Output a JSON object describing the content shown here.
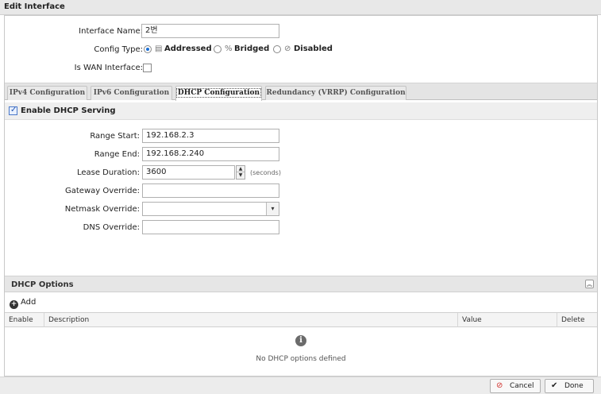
{
  "window": {
    "title": "Edit Interface"
  },
  "interface": {
    "name_label": "Interface Name:",
    "name_value": "2번",
    "config_type_label": "Config Type:",
    "config_types": [
      {
        "label": "Addressed",
        "selected": true,
        "icon": "document-icon"
      },
      {
        "label": "Bridged",
        "selected": false,
        "icon": "link-icon"
      },
      {
        "label": "Disabled",
        "selected": false,
        "icon": "disabled-icon"
      }
    ],
    "wan_label": "Is WAN Interface:",
    "wan_checked": false
  },
  "tabs": [
    {
      "label": "IPv4 Configuration",
      "active": false
    },
    {
      "label": "IPv6 Configuration",
      "active": false
    },
    {
      "label": "DHCP Configuration",
      "active": true
    },
    {
      "label": "Redundancy (VRRP) Configuration",
      "active": false
    }
  ],
  "dhcp": {
    "enable_label": "Enable DHCP Serving",
    "enable_checked": true,
    "range_start_label": "Range Start:",
    "range_start_value": "192.168.2.3",
    "range_end_label": "Range End:",
    "range_end_value": "192.168.2.240",
    "lease_label": "Lease Duration:",
    "lease_value": "3600",
    "lease_unit": "(seconds)",
    "gateway_label": "Gateway Override:",
    "gateway_value": "",
    "netmask_label": "Netmask Override:",
    "netmask_value": "",
    "dns_label": "DNS Override:",
    "dns_value": ""
  },
  "options": {
    "title": "DHCP Options",
    "add_label": "Add",
    "columns": {
      "enable": "Enable",
      "description": "Description",
      "value": "Value",
      "delete": "Delete"
    },
    "empty_text": "No DHCP options defined"
  },
  "footer": {
    "cancel_label": "Cancel",
    "done_label": "Done"
  },
  "colors": {
    "accent": "#1a6fd6",
    "cancel_icon": "#d0312d"
  }
}
